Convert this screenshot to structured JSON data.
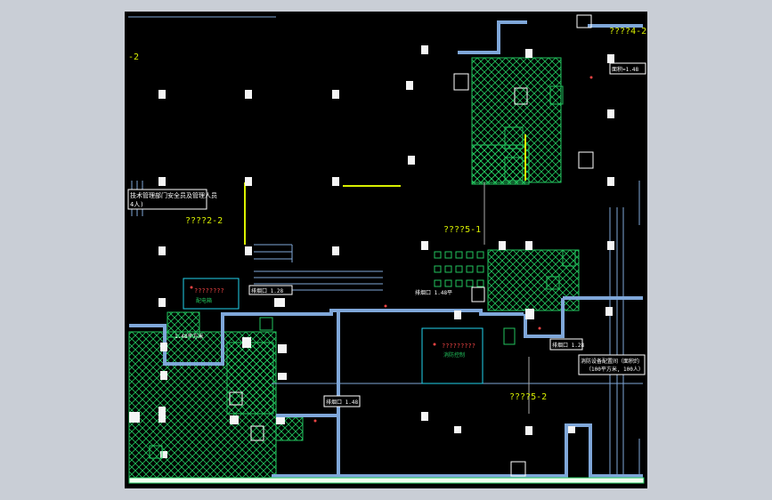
{
  "drawing": {
    "background": "#000000",
    "frame_color": "#c9ced6",
    "colors": {
      "wall": "#7fa7d9",
      "hatch": "#22c55e",
      "label_yellow": "#d9f000",
      "column": "#f5f5f5",
      "cyan": "#22d3ee",
      "red": "#ef4444",
      "white": "#ffffff"
    },
    "labels": {
      "room_top_right": "????4-2",
      "room_left_top": "-2",
      "room_left_mid": "????2-2",
      "room_center": "????5-1",
      "room_lower_right": "????5-2",
      "note_left_line1": "技术管理部门安全员及管理人员",
      "note_left_line2": "4人)",
      "tag_right_top": "面积=1.48",
      "tag_left_small": "1.48平方米",
      "tag_mid_small": "排烟口 1.28",
      "tag_lower_left": "排烟口 1.48",
      "tag_lower_center": "排烟口 1.48平",
      "tag_right_small": "排烟口 1.28",
      "note_right_line1": "消防设备配置间（面积约",
      "note_right_line2": "（100平方米, 100人）",
      "cyan_box1": "????????",
      "cyan_box1_sub": "配电箱",
      "cyan_box2": "?????????",
      "cyan_box2_sub": "消防控制"
    }
  }
}
